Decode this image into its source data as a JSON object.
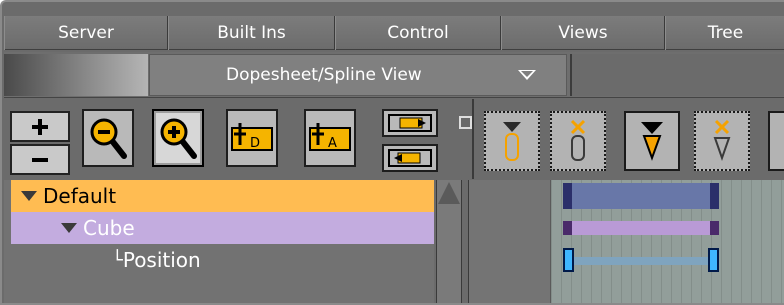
{
  "menu": {
    "tabs": [
      "Server",
      "Built Ins",
      "Control",
      "Views",
      "Tree"
    ]
  },
  "view_selector": {
    "label": "Dopesheet/Spline View"
  },
  "left_toolbar": {
    "buttons": [
      {
        "name": "expand-all",
        "icon": "plus-icon"
      },
      {
        "name": "collapse-all",
        "icon": "minus-icon"
      },
      {
        "name": "zoom-out",
        "icon": "zoom-out-icon"
      },
      {
        "name": "zoom-in",
        "icon": "zoom-in-icon"
      },
      {
        "name": "add-director",
        "icon": "director-icon",
        "text": "D"
      },
      {
        "name": "add-action",
        "icon": "action-icon",
        "text": "A"
      },
      {
        "name": "snap-right",
        "icon": "snap-right-icon"
      },
      {
        "name": "snap-left",
        "icon": "snap-left-icon"
      }
    ]
  },
  "tree": {
    "items": [
      {
        "label": "Default",
        "prefix": ""
      },
      {
        "label": "Cube",
        "prefix": ""
      },
      {
        "label": "Position",
        "prefix": "└"
      }
    ]
  },
  "colors": {
    "default_row": "#ffbc52",
    "cube_row": "#c3acdf",
    "director_bar": "#6877a8",
    "action_bar": "#b99ad6",
    "position_bar": "#7fa4bf",
    "key_icon_accent": "#f5a200"
  }
}
